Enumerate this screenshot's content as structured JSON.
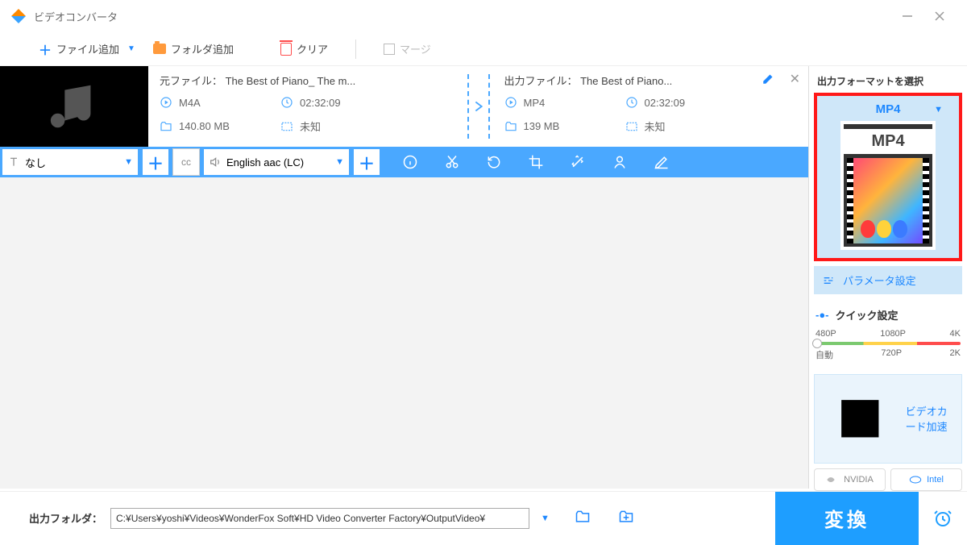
{
  "app_title": "ビデオコンバータ",
  "toolbar": {
    "add_file": "ファイル追加",
    "add_folder": "フォルダ追加",
    "clear": "クリア",
    "merge": "マージ"
  },
  "file": {
    "src": {
      "title": "元ファイル： The Best of Piano_ The m...",
      "format": "M4A",
      "duration": "02:32:09",
      "size": "140.80 MB",
      "resolution": "未知"
    },
    "dst": {
      "title": "出力ファイル： The Best of Piano...",
      "format": "MP4",
      "duration": "02:32:09",
      "size": "139 MB",
      "resolution": "未知"
    }
  },
  "subs": {
    "subtitle_label": "なし",
    "audio_label": "English aac (LC)"
  },
  "right": {
    "select_fmt": "出力フォーマットを選択",
    "fmt_name": "MP4",
    "fmt_box_label": "MP4",
    "param": "パラメータ設定",
    "quick": "クイック設定",
    "res_480": "480P",
    "res_720": "720P",
    "res_1080": "1080P",
    "res_2k": "2K",
    "res_4k": "4K",
    "res_auto": "自動",
    "gpu_accel": "ビデオカード加速",
    "nvidia": "NVIDIA",
    "intel": "Intel"
  },
  "bottom": {
    "out_label": "出力フォルダ：",
    "out_path": "C:¥Users¥yoshi¥Videos¥WonderFox Soft¥HD Video Converter Factory¥OutputVideo¥",
    "convert": "変換"
  }
}
